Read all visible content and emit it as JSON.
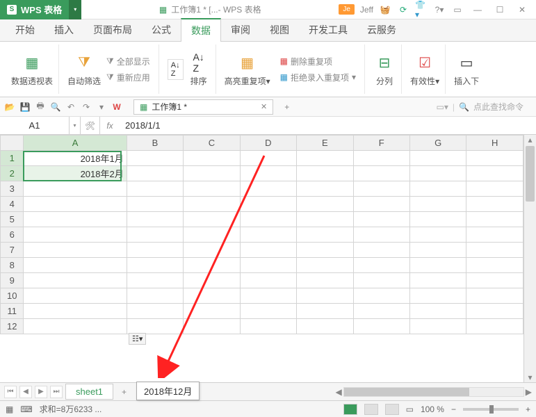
{
  "app": {
    "name": "WPS 表格",
    "doc_title": "工作簿1 * [...- WPS 表格"
  },
  "user": {
    "badge": "Je",
    "name": "Jeff"
  },
  "menu": {
    "items": [
      "开始",
      "插入",
      "页面布局",
      "公式",
      "数据",
      "审阅",
      "视图",
      "开发工具",
      "云服务"
    ],
    "active_index": 4
  },
  "ribbon": {
    "pivot": "数据透视表",
    "autofilter": "自动筛选",
    "show_all": "全部显示",
    "reapply": "重新应用",
    "sort": "排序",
    "highlight_dup": "高亮重复项",
    "remove_dup": "删除重复项",
    "reject_dup": "拒绝录入重复项",
    "split": "分列",
    "validation": "有效性",
    "insert_dd": "插入下"
  },
  "doc_tabs": {
    "active": "工作簿1 *"
  },
  "search_placeholder": "点此查找命令",
  "formula": {
    "name_box": "A1",
    "fx": "fx",
    "value": "2018/1/1"
  },
  "columns": [
    "A",
    "B",
    "C",
    "D",
    "E",
    "F",
    "G",
    "H"
  ],
  "rows": [
    "1",
    "2",
    "3",
    "4",
    "5",
    "6",
    "7",
    "8",
    "9",
    "10",
    "11",
    "12"
  ],
  "cells": {
    "A1": "2018年1月",
    "A2": "2018年2月"
  },
  "autofill_icon": "☷▾",
  "sheet_tabs": {
    "active": "sheet1",
    "tooltip": "2018年12月"
  },
  "status": {
    "sum": "求和=8万6233 ...",
    "zoom": "100 %"
  }
}
